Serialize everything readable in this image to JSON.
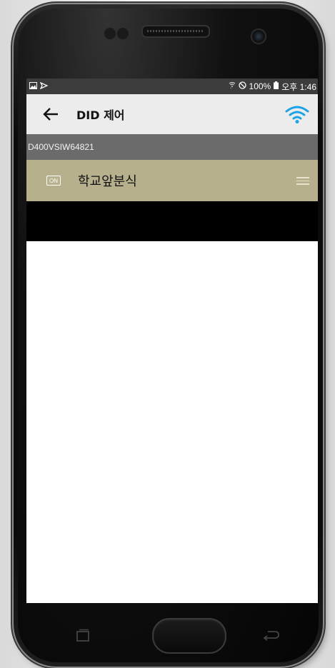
{
  "status_bar": {
    "left_icons": [
      "image-icon",
      "cast-icon"
    ],
    "right_text": "100%",
    "time": "오후 1:46"
  },
  "app_bar": {
    "back_icon": "arrow-left-icon",
    "title": "DID 제어",
    "wifi_icon": "wifi-icon",
    "wifi_color": "#1aa3e8"
  },
  "device": {
    "id": "D400VSIW64821"
  },
  "list": {
    "items": [
      {
        "badge": "ON",
        "label": "학교앞분식",
        "handle_icon": "drag-handle-icon"
      }
    ],
    "item_color": "#b6b08c"
  },
  "nav": {
    "recent_icon": "recent-apps-icon",
    "home_icon": "home-button",
    "back_icon": "back-arrow-icon"
  }
}
